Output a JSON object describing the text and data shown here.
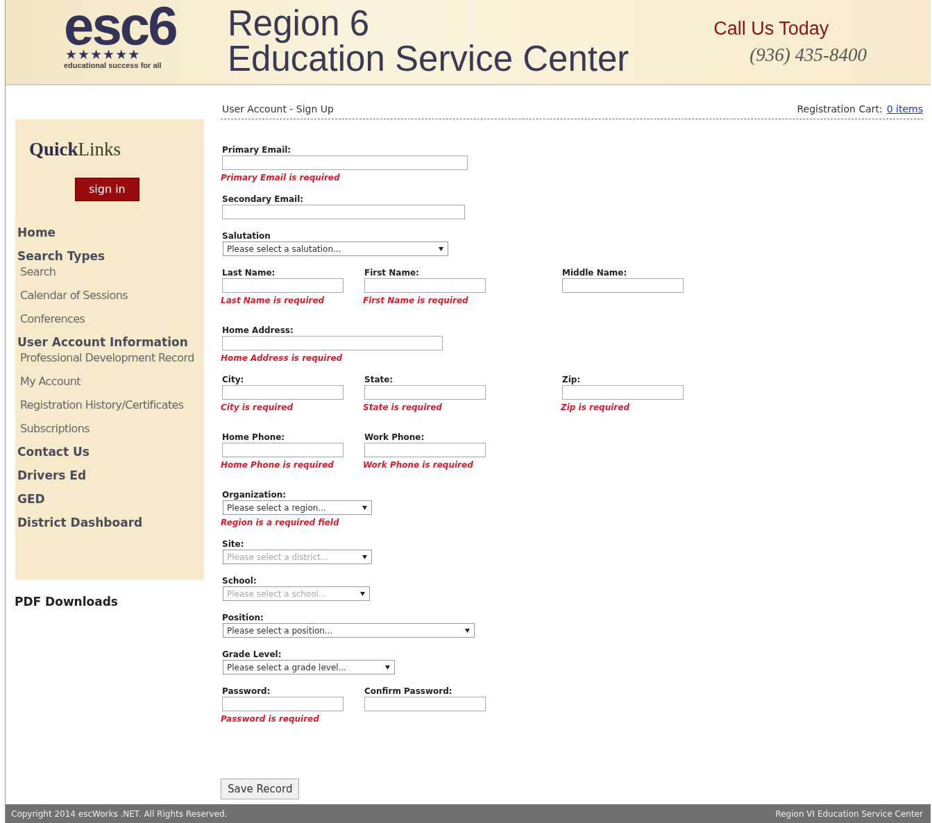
{
  "header": {
    "logo_text": "esc6",
    "logo_stars": "★★★★★★",
    "logo_tagline": "educational success for all",
    "title_line_1": "Region 6",
    "title_line_2": "Education Service Center",
    "call_label": "Call Us Today",
    "phone": "(936) 435-8400"
  },
  "sidebar": {
    "title": "**Quick**Links",
    "sign_in": "sign in",
    "items": [
      {
        "label": "Home"
      },
      {
        "label": "Search Types",
        "children": [
          {
            "label": "Search"
          },
          {
            "label": "Calendar of Sessions"
          },
          {
            "label": "Conferences"
          }
        ]
      },
      {
        "label": "User Account Information",
        "children": [
          {
            "label": "Professional Development Record"
          },
          {
            "label": "My Account"
          },
          {
            "label": "Registration History/Certificates"
          },
          {
            "label": "Subscriptions"
          }
        ]
      },
      {
        "label": "Contact Us"
      },
      {
        "label": "Drivers Ed"
      },
      {
        "label": "GED"
      },
      {
        "label": "District Dashboard"
      }
    ],
    "below": "PDF Downloads"
  },
  "breadcrumb": "User Account - Sign Up",
  "cart": {
    "label": "Registration Cart:",
    "link": "0 items"
  },
  "form": {
    "rows": [
      [
        {
          "label": "Primary Email:",
          "kind": "text",
          "error": "Primary Email is required"
        }
      ],
      [
        {
          "label": "Secondary Email:",
          "kind": "text"
        }
      ],
      [
        {
          "label": "Salutation",
          "kind": "select",
          "value": "Please select a salutation...",
          "disabled": false
        }
      ],
      [
        {
          "label": "Last Name:",
          "kind": "text",
          "error": "Last Name is required"
        },
        {
          "label": "First Name:",
          "kind": "text",
          "error": "First Name is required"
        },
        {
          "label": "Middle Name:",
          "kind": "text"
        }
      ],
      [
        {
          "label": "Home Address:",
          "kind": "text",
          "error": "Home Address is required"
        }
      ],
      [
        {
          "label": "City:",
          "kind": "text",
          "error": "City is required"
        },
        {
          "label": "State:",
          "kind": "text",
          "error": "State is required"
        },
        {
          "label": "Zip:",
          "kind": "text",
          "error": "Zip is required"
        }
      ],
      [
        {
          "label": "Home Phone:",
          "kind": "text",
          "error": "Home Phone is required"
        },
        {
          "label": "Work Phone:",
          "kind": "text",
          "error": "Work Phone is required"
        }
      ],
      [
        {
          "label": "Organization:",
          "kind": "select",
          "value": "Please select a region...",
          "disabled": false,
          "error": "Region is a required field"
        }
      ],
      [
        {
          "label": "Site:",
          "kind": "select",
          "value": "Please select a district...",
          "disabled": true
        }
      ],
      [
        {
          "label": "School:",
          "kind": "select",
          "value": "Please select a school...",
          "disabled": true
        }
      ],
      [
        {
          "label": "Position:",
          "kind": "select",
          "value": "Please select a position...",
          "disabled": false
        }
      ],
      [
        {
          "label": "Grade Level:",
          "kind": "select",
          "value": "Please select a grade level...",
          "disabled": false
        }
      ],
      [
        {
          "label": "Password:",
          "kind": "text",
          "error": "Password is required"
        },
        {
          "label": "Confirm Password:",
          "kind": "text"
        }
      ]
    ],
    "submit": "Save Record"
  },
  "footer": {
    "copyright": "Copyright 2014 escWorks .NET. All Rights Reserved.",
    "org": "Region VI Education Service Center"
  }
}
